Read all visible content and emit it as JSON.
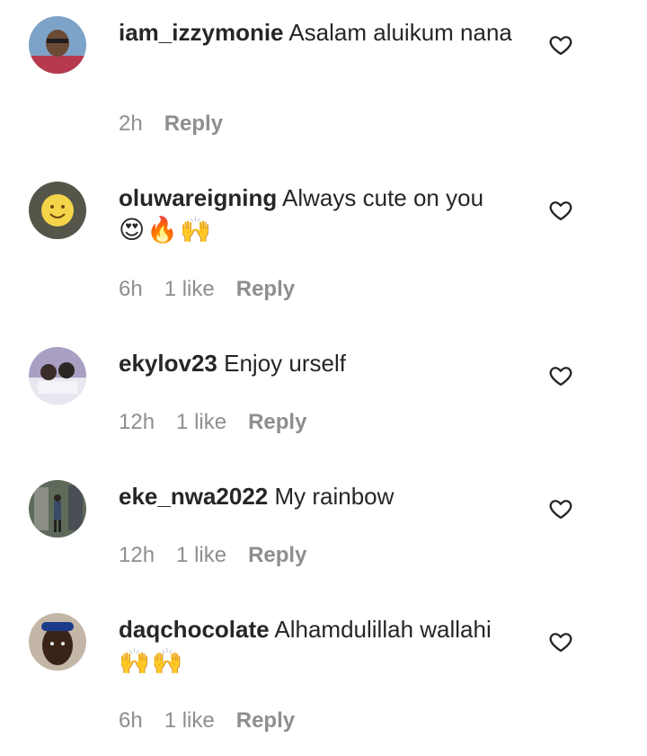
{
  "comments": [
    {
      "username": "iam_izzymonie",
      "text": "Asalam aluikum nana",
      "emoji": "",
      "time": "2h",
      "likes": "",
      "reply": "Reply",
      "heart_icon": "heart-outline-icon",
      "avatar_colors": [
        "#6a8fb8",
        "#b63a4e"
      ]
    },
    {
      "username": "oluwareigning",
      "text": "Always cute on you",
      "emoji": "😍🔥🙌",
      "time": "6h",
      "likes": "1 like",
      "reply": "Reply",
      "heart_icon": "heart-outline-icon",
      "avatar_colors": [
        "#5a5a4a",
        "#f2d64b"
      ]
    },
    {
      "username": "ekylov23",
      "text": "Enjoy urself",
      "emoji": "",
      "time": "12h",
      "likes": "1 like",
      "reply": "Reply",
      "heart_icon": "heart-outline-icon",
      "avatar_colors": [
        "#9a8fb0",
        "#2c2a36"
      ]
    },
    {
      "username": "eke_nwa2022",
      "text": "My rainbow",
      "emoji": "",
      "time": "12h",
      "likes": "1 like",
      "reply": "Reply",
      "heart_icon": "heart-outline-icon",
      "avatar_colors": [
        "#6b7666",
        "#3a3f46"
      ]
    },
    {
      "username": "daqchocolate",
      "text": "Alhamdulillah wallahi",
      "emoji": "🙌🙌",
      "time": "6h",
      "likes": "1 like",
      "reply": "Reply",
      "heart_icon": "heart-outline-icon",
      "avatar_colors": [
        "#b8a899",
        "#3a2418"
      ]
    }
  ],
  "colors": {
    "text": "#262626",
    "meta": "#8e8e8e",
    "background": "#ffffff"
  }
}
